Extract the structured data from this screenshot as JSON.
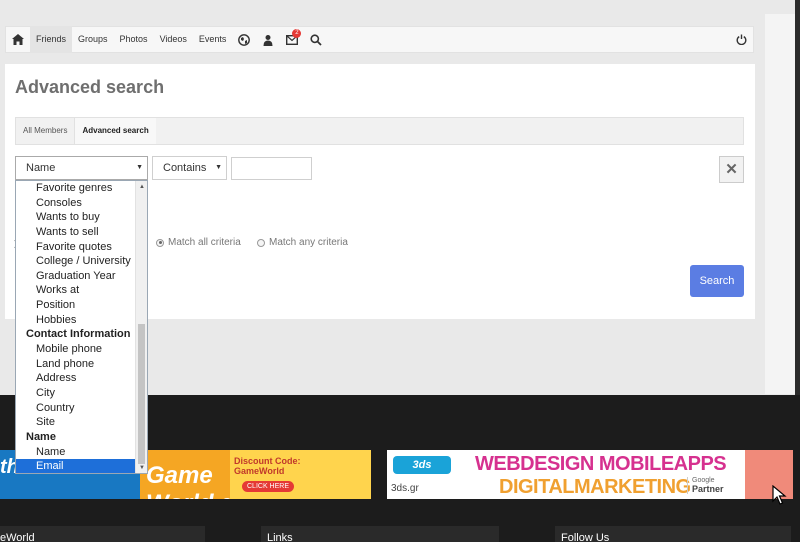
{
  "nav": {
    "items": [
      "Friends",
      "Groups",
      "Photos",
      "Videos",
      "Events"
    ],
    "badge_count": "2"
  },
  "page": {
    "title": "Advanced search",
    "tabs": [
      "All Members",
      "Advanced search"
    ]
  },
  "filter": {
    "field_value": "Name",
    "operator_value": "Contains",
    "remove_label": "✕"
  },
  "criteria": {
    "all_label": "Match all criteria",
    "any_label": "Match any criteria"
  },
  "search_button": "Search",
  "dropdown": {
    "items": [
      {
        "label": "Favorite genres",
        "type": "option"
      },
      {
        "label": "Consoles",
        "type": "option"
      },
      {
        "label": "Wants to buy",
        "type": "option"
      },
      {
        "label": "Wants to sell",
        "type": "option"
      },
      {
        "label": "Favorite quotes",
        "type": "option"
      },
      {
        "label": "College / University",
        "type": "option"
      },
      {
        "label": "Graduation Year",
        "type": "option"
      },
      {
        "label": "Works at",
        "type": "option"
      },
      {
        "label": "Position",
        "type": "option"
      },
      {
        "label": "Hobbies",
        "type": "option"
      },
      {
        "label": "Contact Information",
        "type": "group"
      },
      {
        "label": "Mobile phone",
        "type": "option"
      },
      {
        "label": "Land phone",
        "type": "option"
      },
      {
        "label": "Address",
        "type": "option"
      },
      {
        "label": "City",
        "type": "option"
      },
      {
        "label": "Country",
        "type": "option"
      },
      {
        "label": "Site",
        "type": "option"
      },
      {
        "label": "Name",
        "type": "group"
      },
      {
        "label": "Name",
        "type": "option"
      },
      {
        "label": "Email",
        "type": "option",
        "selected": true
      }
    ]
  },
  "banners": {
    "left": {
      "brand": "theGamers",
      "logo": "Game World.gr",
      "discount_line1": "Discount Code:",
      "discount_line2": "GameWorld",
      "cta": "CLICK HERE"
    },
    "right": {
      "logo": "3ds",
      "headline1": "WEBDESIGN MOBILEAPPS",
      "headline2": "DIGITALMARKETING",
      "url": "3ds.gr",
      "partner_line1": "Google",
      "partner_line2": "Partner"
    }
  },
  "footer": {
    "col1": "eWorld",
    "col2": "Links",
    "col3": "Follow Us"
  },
  "colors": {
    "primary_button": "#5b7de3",
    "selected_option": "#1e6fd9"
  }
}
